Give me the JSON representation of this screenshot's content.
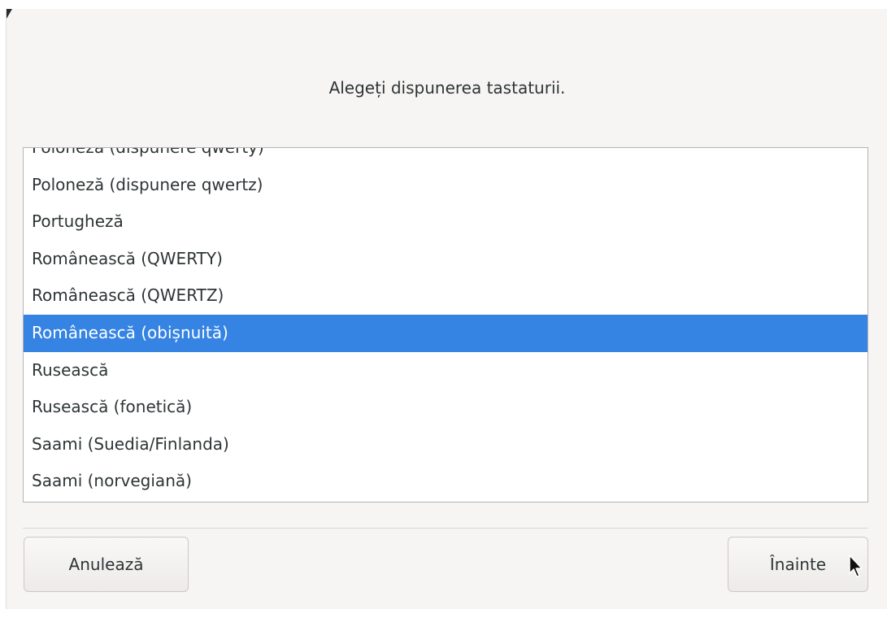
{
  "dialog": {
    "heading": "Alegeți dispunerea tastaturii."
  },
  "layout_list": {
    "selected_index": 5,
    "items": [
      "Poloneză (dispunere qwerty)",
      "Poloneză (dispunere qwertz)",
      "Portugheză",
      "Românească (QWERTY)",
      "Românească (QWERTZ)",
      "Românească (obișnuită)",
      "Rusească",
      "Rusească (fonetică)",
      "Saami (Suedia/Finlanda)",
      "Saami (norvegiană)"
    ]
  },
  "buttons": {
    "cancel_label": "Anulează",
    "next_label": "Înainte"
  },
  "colors": {
    "selection": "#3584e4",
    "dialog_bg": "#f6f5f4"
  }
}
